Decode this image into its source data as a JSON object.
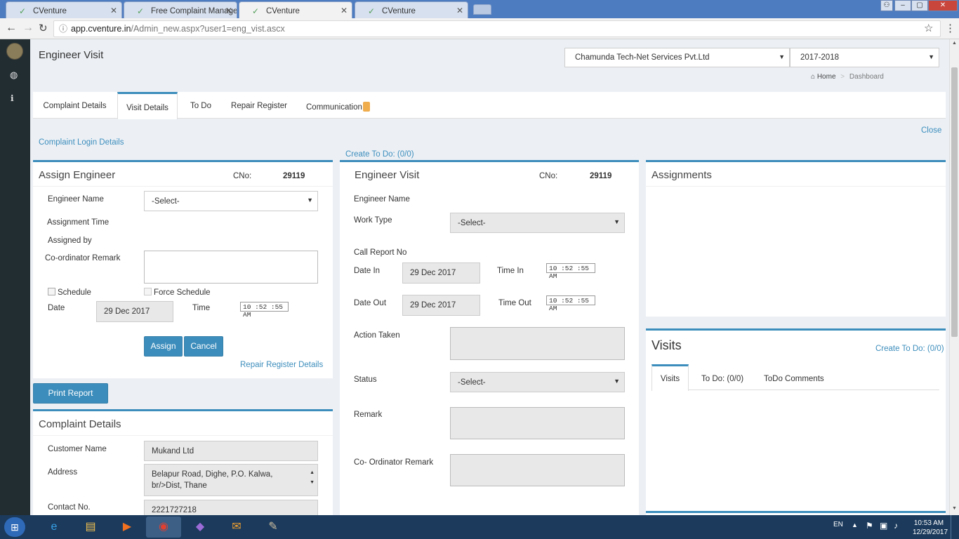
{
  "browser": {
    "tabs": [
      {
        "title": "CVenture",
        "active": false
      },
      {
        "title": "Free Complaint Manager",
        "active": false
      },
      {
        "title": "CVenture",
        "active": true
      },
      {
        "title": "CVenture",
        "active": false
      }
    ],
    "url_host": "app.cventure.in",
    "url_path": "/Admin_new.aspx?user1=eng_vist.ascx"
  },
  "header": {
    "page_title": "Engineer Visit",
    "company_select": "Chamunda Tech-Net Services Pvt.Ltd",
    "year_select": "2017-2018",
    "breadcrumb_home": "Home",
    "breadcrumb_sep": ">",
    "breadcrumb_current": "Dashboard"
  },
  "tabs": [
    {
      "label": "Complaint Details",
      "active": false
    },
    {
      "label": "Visit Details",
      "active": true
    },
    {
      "label": "To Do",
      "active": false
    },
    {
      "label": "Repair Register",
      "active": false
    },
    {
      "label": "Communication",
      "active": false
    }
  ],
  "close_link": "Close",
  "complaint_login_link": "Complaint Login Details",
  "create_todo_top": "Create To Do: (0/0)",
  "assign": {
    "title": "Assign Engineer",
    "cno_label": "CNo:",
    "cno_value": "29119",
    "engineer_name_label": "Engineer Name",
    "engineer_select": "-Select-",
    "assignment_time_label": "Assignment Time",
    "assigned_by_label": "Assigned by",
    "coordinator_remark_label": "Co-ordinator Remark",
    "schedule_label": "Schedule",
    "force_schedule_label": "Force Schedule",
    "date_label": "Date",
    "date_value": "29 Dec 2017",
    "time_label": "Time",
    "time_value": "10 :52 :55 AM",
    "assign_button": "Assign",
    "cancel_button": "Cancel",
    "repair_register_link": "Repair Register Details"
  },
  "print_report_button": "Print Report",
  "complaint_details": {
    "title": "Complaint Details",
    "customer_name_label": "Customer Name",
    "customer_name_value": "Mukand Ltd",
    "address_label": "Address",
    "address_line1": "Belapur Road, Dighe, P.O. Kalwa,",
    "address_line2": "br/>Dist, Thane",
    "contact_label": "Contact No.",
    "contact_value": "2221727218"
  },
  "visit": {
    "title": "Engineer Visit",
    "cno_label": "CNo:",
    "cno_value": "29119",
    "engineer_name_label": "Engineer Name",
    "work_type_label": "Work Type",
    "work_type_select": "-Select-",
    "call_report_label": "Call Report No",
    "date_in_label": "Date In",
    "date_in_value": "29 Dec 2017",
    "time_in_label": "Time In",
    "time_in_value": "10 :52 :55 AM",
    "date_out_label": "Date Out",
    "date_out_value": "29 Dec 2017",
    "time_out_label": "Time Out",
    "time_out_value": "10 :52 :55 AM",
    "action_taken_label": "Action Taken",
    "status_label": "Status",
    "status_select": "-Select-",
    "remark_label": "Remark",
    "coordinator_remark_label": "Co- Ordinator Remark"
  },
  "assignments": {
    "title": "Assignments"
  },
  "visits": {
    "title": "Visits",
    "create_todo": "Create To Do: (0/0)",
    "tabs": [
      {
        "label": "Visits",
        "active": true
      },
      {
        "label": "To Do: (0/0)",
        "active": false
      },
      {
        "label": "ToDo Comments",
        "active": false
      }
    ]
  },
  "taskbar": {
    "lang": "EN",
    "time": "10:53 AM",
    "date": "12/29/2017"
  }
}
